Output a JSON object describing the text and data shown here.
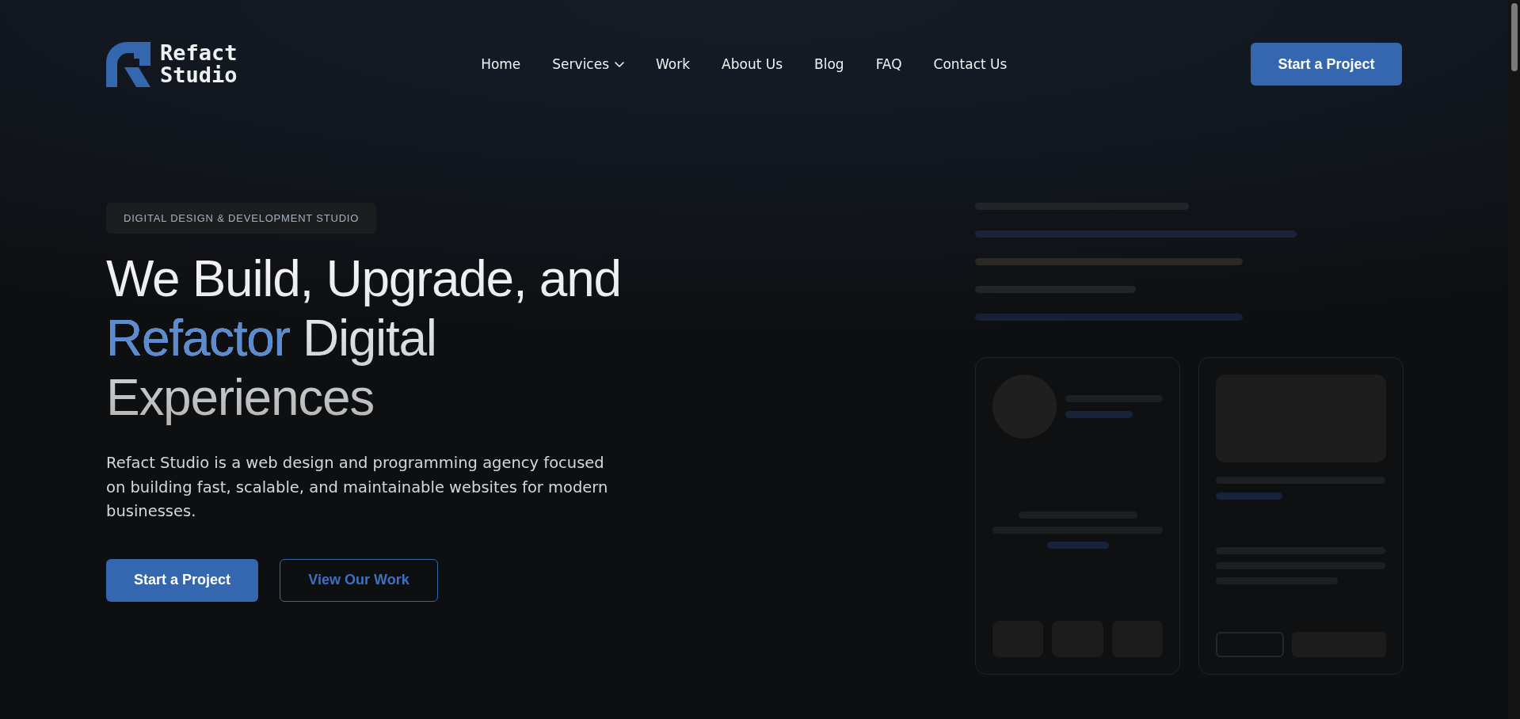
{
  "header": {
    "brand": "Refact Studio",
    "nav": [
      {
        "label": "Home",
        "dropdown": false
      },
      {
        "label": "Services",
        "dropdown": true
      },
      {
        "label": "Work",
        "dropdown": false
      },
      {
        "label": "About Us",
        "dropdown": false
      },
      {
        "label": "Blog",
        "dropdown": false
      },
      {
        "label": "FAQ",
        "dropdown": false
      },
      {
        "label": "Contact Us",
        "dropdown": false
      }
    ],
    "button": "Start a Project"
  },
  "hero": {
    "eyebrow": "DIGITAL DESIGN & DEVELOPMENT STUDIO",
    "heading": [
      {
        "text": "We Build, Upgrade, and ",
        "accent": false
      },
      {
        "text": "Refactor",
        "accent": true
      },
      {
        "text": " Digital Experiences",
        "accent": false
      }
    ],
    "description": "Refact Studio is a web design and programming agency focused on building fast, scalable, and maintainable websites for modern businesses.",
    "buttons": [
      {
        "label": "Start a Project",
        "kind": "primary"
      },
      {
        "label": "View Our Work",
        "kind": "outline"
      }
    ]
  }
}
